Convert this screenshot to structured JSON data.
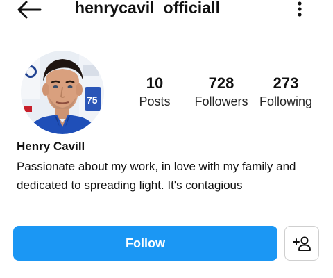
{
  "header": {
    "username": "henrycavil_officiall",
    "back_icon": "arrow-left-icon",
    "more_icon": "more-vertical-icon"
  },
  "profile": {
    "avatar_alt": "profile-photo",
    "stats": {
      "posts": {
        "value": "10",
        "label": "Posts"
      },
      "followers": {
        "value": "728",
        "label": "Followers"
      },
      "following": {
        "value": "273",
        "label": "Following"
      }
    },
    "name": "Henry Cavill",
    "bio": "Passionate about my work, in love with my family and dedicated to spreading light. It's contagious"
  },
  "actions": {
    "follow_label": "Follow",
    "add_user_icon": "add-person-icon"
  },
  "colors": {
    "accent": "#1b97f4",
    "background": "#ffffff",
    "text": "#111111"
  }
}
